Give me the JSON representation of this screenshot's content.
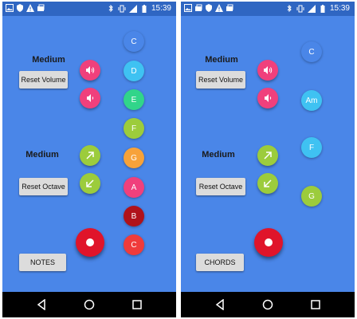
{
  "screens": [
    {
      "status_time": "15:39",
      "volume_level": "Medium",
      "reset_volume": "Reset Volume",
      "octave_level": "Medium",
      "reset_octave": "Reset Octave",
      "mode_button": "NOTES",
      "keys": [
        "C",
        "D",
        "E",
        "F",
        "G",
        "A",
        "B",
        "C"
      ]
    },
    {
      "status_time": "15:39",
      "volume_level": "Medium",
      "reset_volume": "Reset Volume",
      "octave_level": "Medium",
      "reset_octave": "Reset Octave",
      "mode_button": "CHORDS",
      "keys": [
        "C",
        "Am",
        "F",
        "G"
      ]
    }
  ],
  "colors": {
    "background": "#4a86e8",
    "status_bar": "#2f66c2",
    "pink": "#f0407c",
    "green_arrow": "#9ccc3c",
    "record": "#e0142a",
    "key_colors_notes": [
      "#4a86e8",
      "#3fc2f2",
      "#31d58a",
      "#9ccc3c",
      "#f7a23a",
      "#f0407c",
      "#b0121b",
      "#f03b3b"
    ],
    "key_colors_chords": [
      "#4a86e8",
      "#3fc2f2",
      "#3fc2f2",
      "#9ccc3c"
    ]
  },
  "icons": {
    "status_left": [
      "image-icon",
      "shield-icon",
      "warning-icon",
      "photos-icon"
    ],
    "status_right": [
      "bluetooth-icon",
      "vibrate-icon",
      "signal-icon",
      "battery-icon"
    ],
    "volume_up": "volume-up-icon",
    "volume_down": "volume-down-icon",
    "octave_up": "arrow-up-right-icon",
    "octave_down": "arrow-down-left-icon",
    "record": "record-icon",
    "nav": [
      "back-icon",
      "home-icon",
      "recents-icon"
    ]
  }
}
